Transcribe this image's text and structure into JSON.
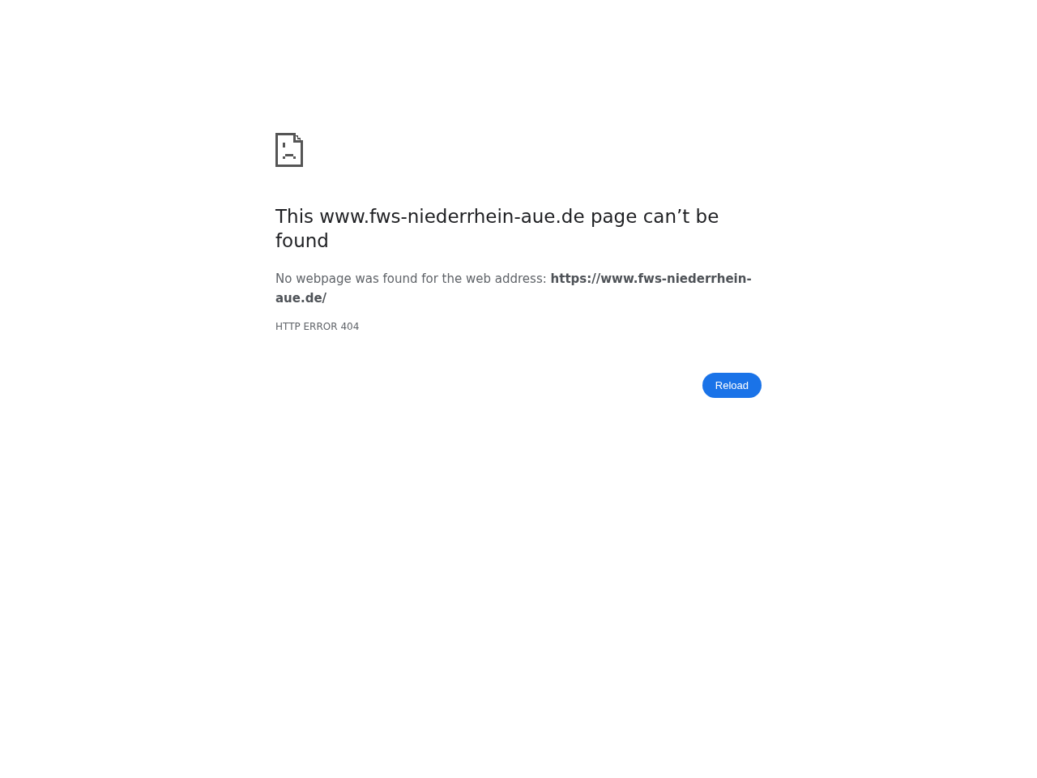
{
  "heading": "This www.fws-niederrhein-aue.de page can’t be found",
  "message": "No webpage was found for the web address: **https://www.fws-niederrhein-aue.de/**",
  "error_code": "HTTP ERROR 404",
  "buttons": [
    {
      "label": "Reload"
    }
  ]
}
